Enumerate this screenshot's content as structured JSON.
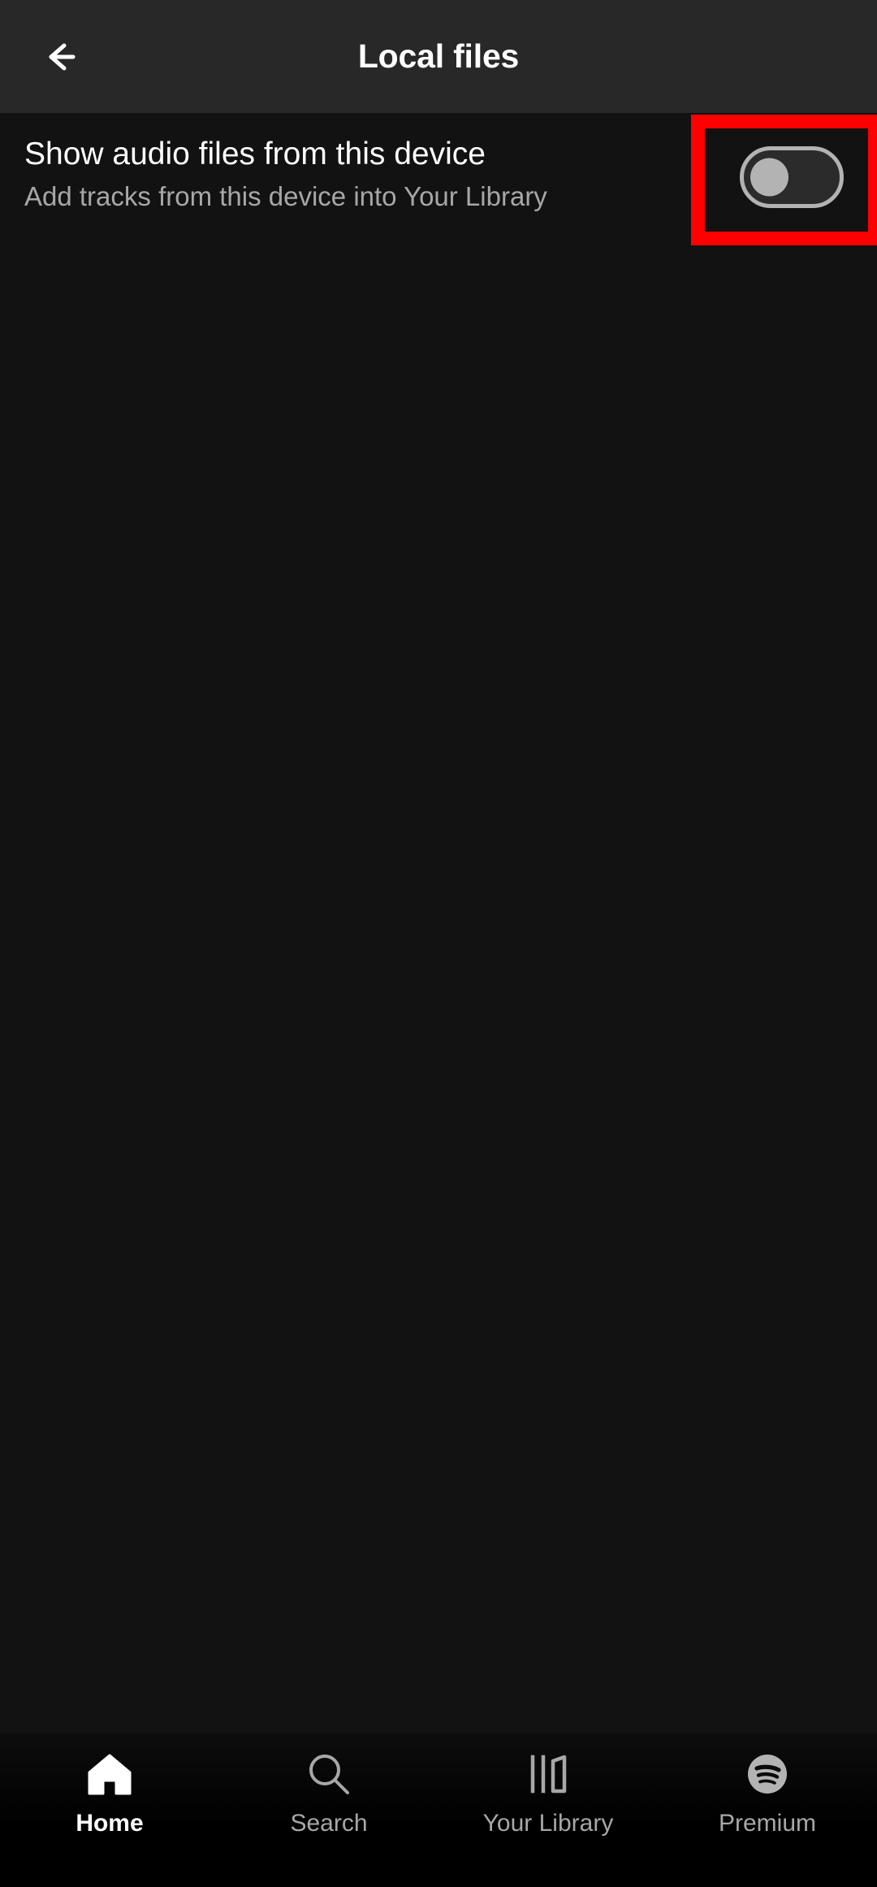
{
  "header": {
    "title": "Local files",
    "back_icon": "arrow-left-icon",
    "background_color": "#282828"
  },
  "setting": {
    "title": "Show audio files from this device",
    "subtitle": "Add tracks from this device into Your Library",
    "toggle": {
      "name": "show-audio-files-toggle",
      "state": "off",
      "knob_color": "#b3b3b3",
      "track_border_color": "#b3b3b3",
      "track_fill_color": "#2b2b2b"
    }
  },
  "annotation": {
    "highlight_color": "#ff0000",
    "target": "show-audio-files-toggle"
  },
  "bottom_nav": {
    "items": [
      {
        "label": "Home",
        "icon": "home-icon",
        "active": true
      },
      {
        "label": "Search",
        "icon": "search-icon",
        "active": false
      },
      {
        "label": "Your Library",
        "icon": "library-icon",
        "active": false
      },
      {
        "label": "Premium",
        "icon": "spotify-icon",
        "active": false
      }
    ],
    "active_color": "#ffffff",
    "inactive_color": "#a7a7a7"
  },
  "theme": {
    "background": "#121212",
    "nav_background": "#000000"
  }
}
